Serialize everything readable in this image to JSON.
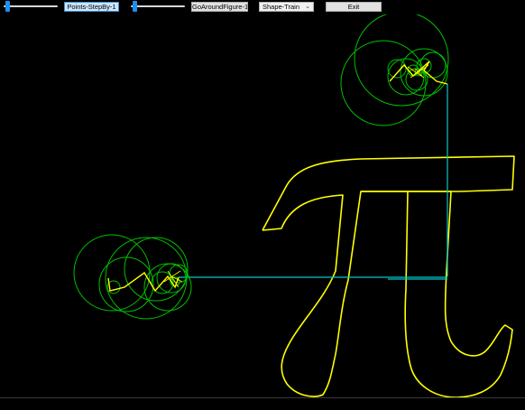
{
  "toolbar": {
    "slider_points": {
      "value": 0.0
    },
    "points_button_label": "Points-StepBy-1",
    "slider_around": {
      "value": 0.0
    },
    "around_button_label": "GoAroundFigure-1",
    "shape_select": {
      "selected": "Shape-Train"
    },
    "exit_label": "Exit"
  },
  "colors": {
    "background": "#000000",
    "figure": "#ffff00",
    "circles": "#00c000",
    "linkage": "#ffff00",
    "tracer_line": "#00c8c8"
  },
  "scene": {
    "figure": "pi-symbol",
    "epicycle_sets": [
      "top-epicycles",
      "left-epicycles"
    ]
  }
}
